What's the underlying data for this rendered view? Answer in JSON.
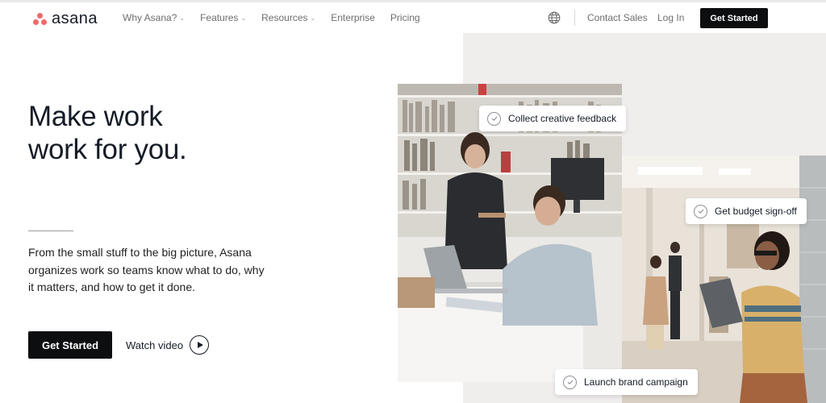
{
  "brand": {
    "name": "asana",
    "color": "#f06a6a"
  },
  "nav": {
    "links": [
      {
        "label": "Why Asana?",
        "has_dropdown": true
      },
      {
        "label": "Features",
        "has_dropdown": true
      },
      {
        "label": "Resources",
        "has_dropdown": true
      },
      {
        "label": "Enterprise",
        "has_dropdown": false
      },
      {
        "label": "Pricing",
        "has_dropdown": false
      }
    ],
    "globe_icon": "globe-icon",
    "contact_sales": "Contact Sales",
    "login": "Log In",
    "cta": "Get Started"
  },
  "hero": {
    "headline_line1": "Make work",
    "headline_line2": "work for you.",
    "subtext": "From the small stuff to the big picture, Asana organizes work so teams know what to do, why it matters, and how to get it done.",
    "cta_primary": "Get Started",
    "cta_secondary": "Watch video",
    "play_icon": "play-circle-icon"
  },
  "task_pills": [
    {
      "label": "Collect creative feedback"
    },
    {
      "label": "Get budget sign-off"
    },
    {
      "label": "Launch brand campaign"
    }
  ]
}
